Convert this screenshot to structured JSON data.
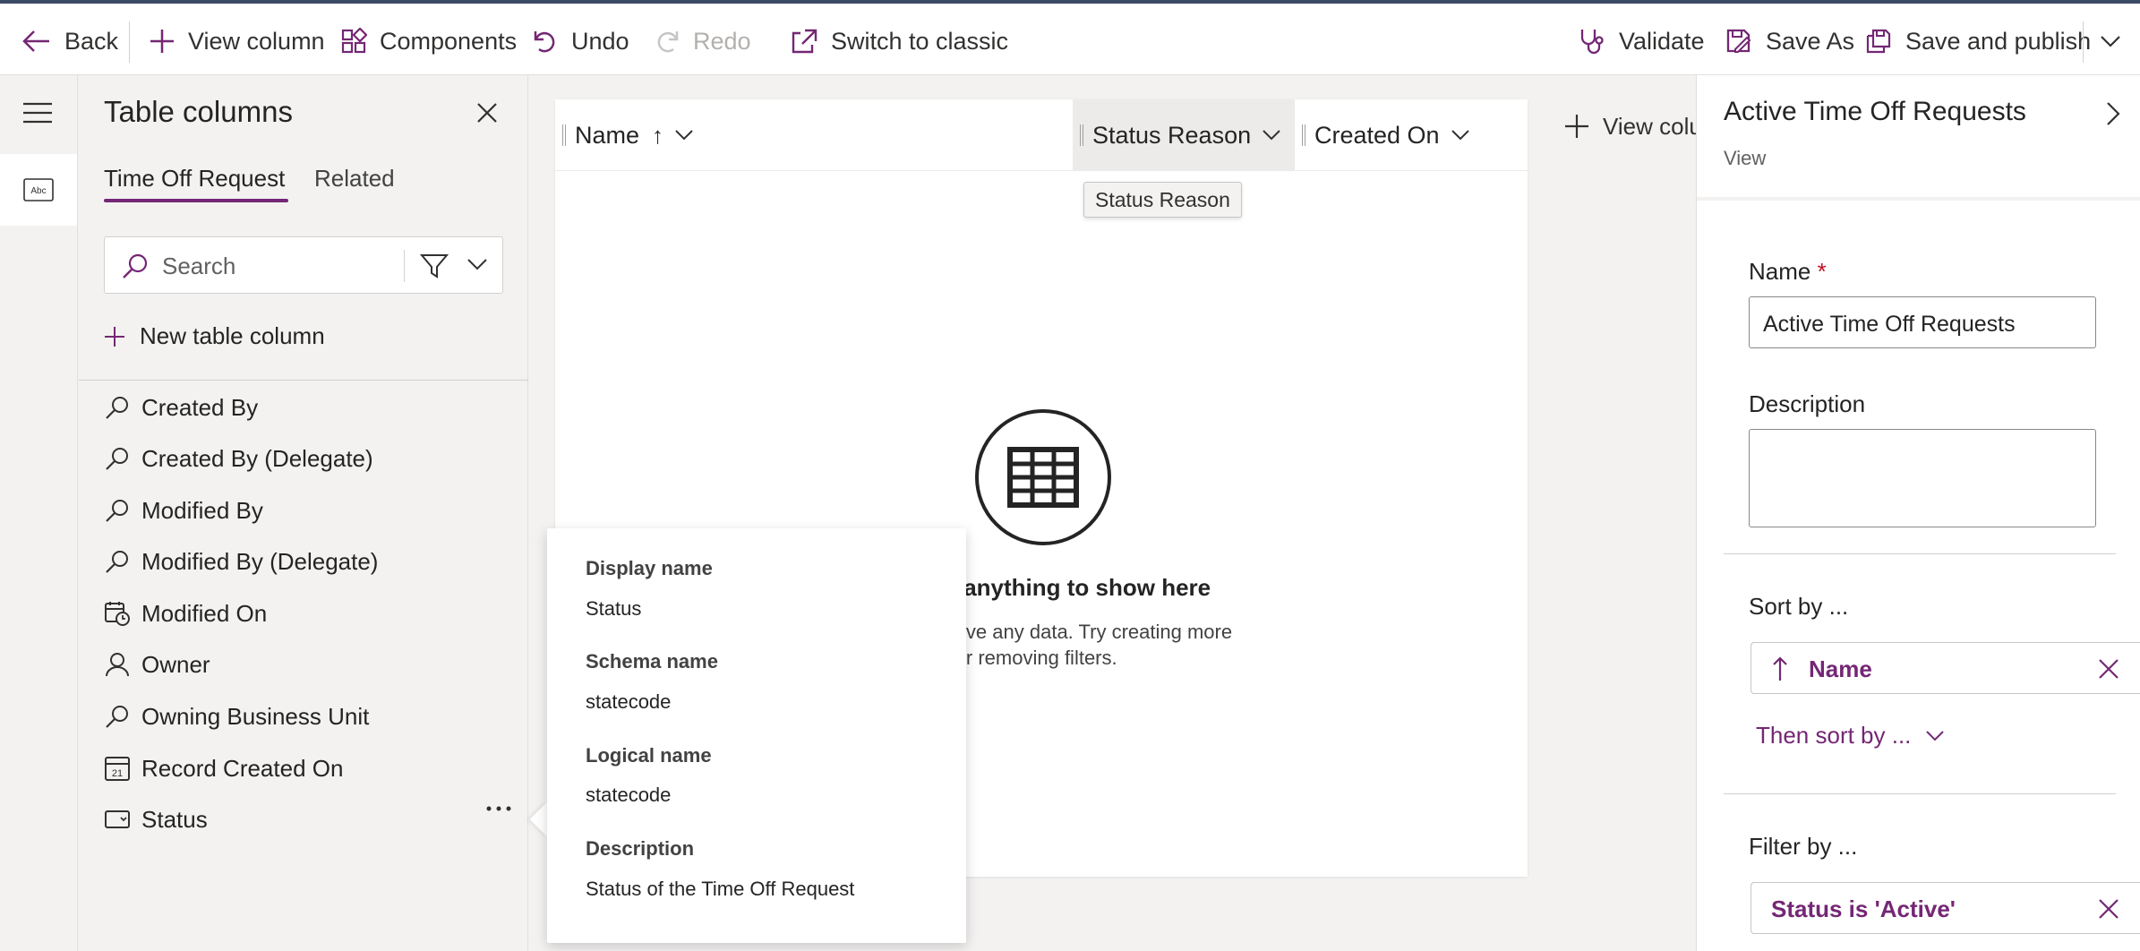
{
  "toolbar": {
    "back": "Back",
    "view_column": "View column",
    "components": "Components",
    "undo": "Undo",
    "redo": "Redo",
    "switch_classic": "Switch to classic",
    "validate": "Validate",
    "save_as": "Save As",
    "save_publish": "Save and publish"
  },
  "panel": {
    "title": "Table columns",
    "tabs": [
      "Time Off Request",
      "Related"
    ],
    "search_placeholder": "Search",
    "new_column": "New table column",
    "columns": [
      {
        "label": "Created By",
        "icon": "lookup-icon"
      },
      {
        "label": "Created By (Delegate)",
        "icon": "lookup-icon"
      },
      {
        "label": "Modified By",
        "icon": "lookup-icon"
      },
      {
        "label": "Modified By (Delegate)",
        "icon": "lookup-icon"
      },
      {
        "label": "Modified On",
        "icon": "calendar-clock-icon"
      },
      {
        "label": "Owner",
        "icon": "person-icon"
      },
      {
        "label": "Owning Business Unit",
        "icon": "lookup-icon"
      },
      {
        "label": "Record Created On",
        "icon": "calendar-icon"
      },
      {
        "label": "Status",
        "icon": "choice-icon"
      }
    ]
  },
  "grid": {
    "columns": [
      "Name",
      "Status Reason",
      "Created On"
    ],
    "sort_arrow": "↑",
    "tooltip": "Status Reason",
    "empty_title": "We didn't find anything to show here",
    "empty_title_visible": "ind anything to show here",
    "empty_text_line1": "ot have any data. Try creating more",
    "empty_text_line2": "rds or removing filters.",
    "view_column_btn": "View colu"
  },
  "popup": {
    "display_name_label": "Display name",
    "display_name": "Status",
    "schema_name_label": "Schema name",
    "schema_name": "statecode",
    "logical_name_label": "Logical name",
    "logical_name": "statecode",
    "description_label": "Description",
    "description": "Status of the Time Off Request"
  },
  "properties": {
    "title": "Active Time Off Requests",
    "subtitle": "View",
    "name_label": "Name",
    "required_mark": "*",
    "name_value": "Active Time Off Requests",
    "description_label": "Description",
    "description_value": "",
    "sort_label": "Sort by ...",
    "sort_value": "Name",
    "then_sort": "Then sort by ...",
    "filter_label": "Filter by ...",
    "filter_value": "Status is 'Active'"
  },
  "colors": {
    "accent": "#742774",
    "topbar_border": "#3b4a66",
    "background": "#f3f2f1"
  }
}
